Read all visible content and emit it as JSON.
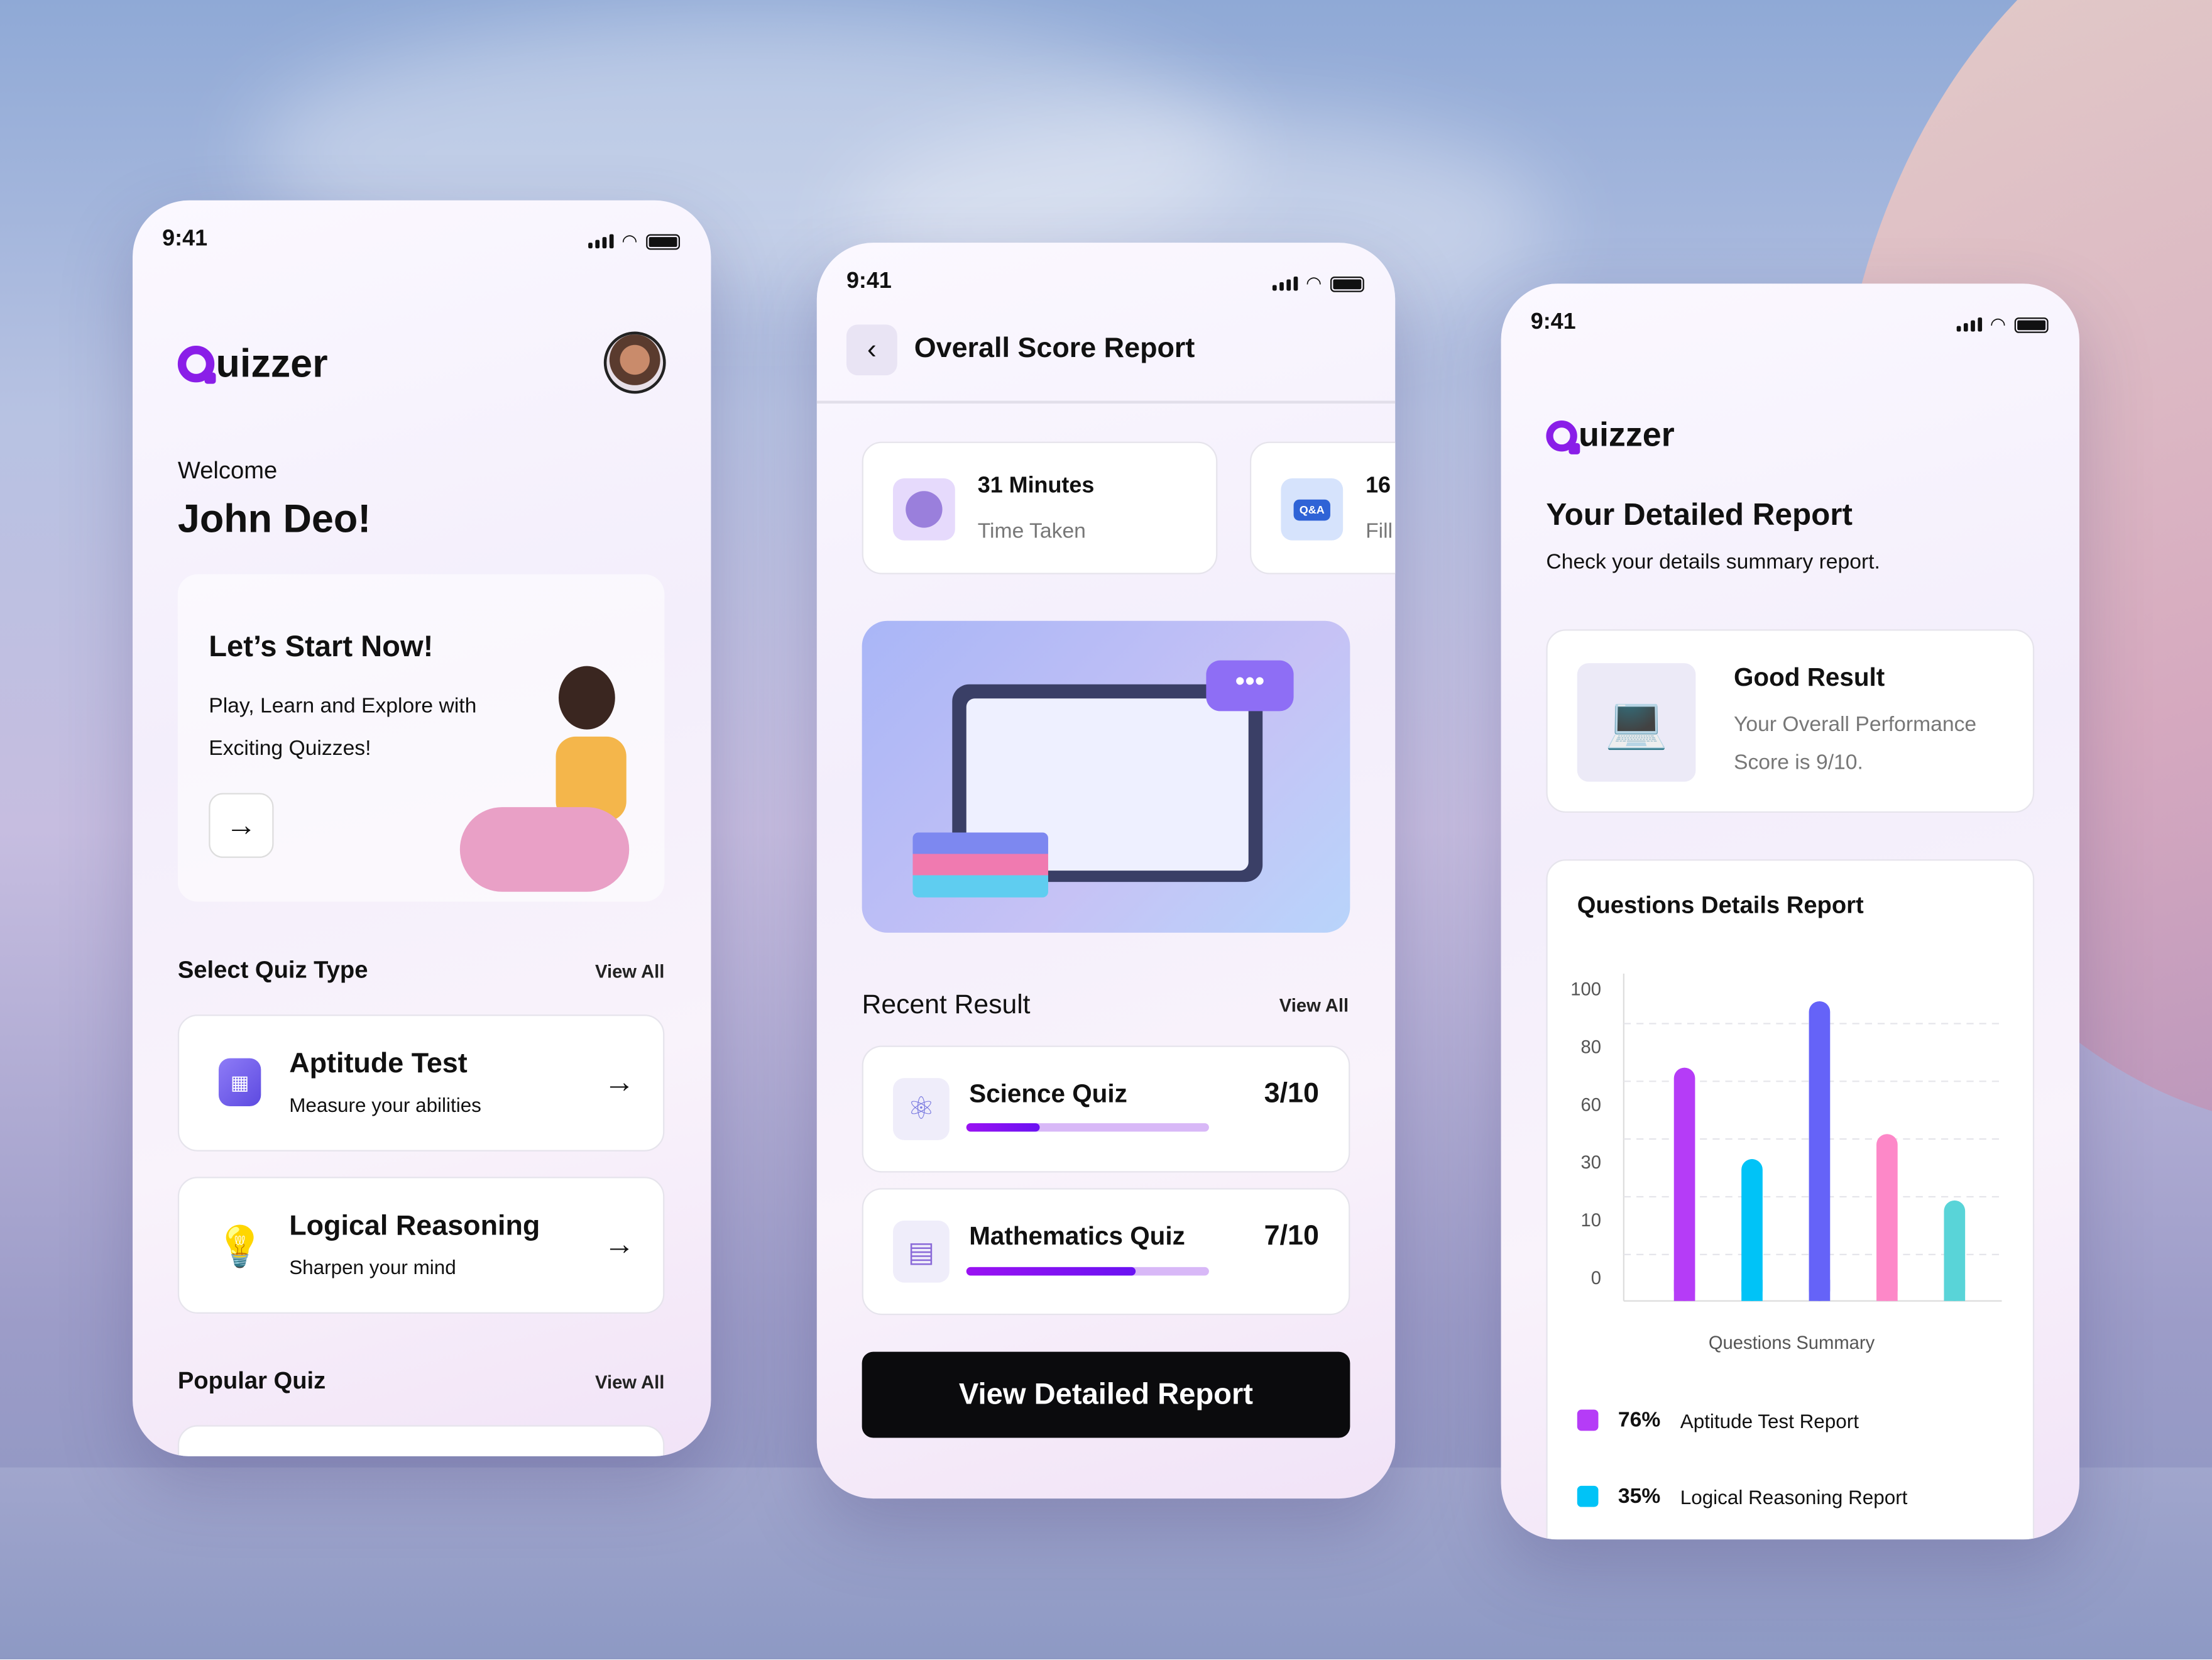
{
  "status_time": "9:41",
  "brand": {
    "name_rest": "uizzer",
    "accent": "#8a1ee8"
  },
  "home": {
    "welcome": "Welcome",
    "user_name": "John Deo!",
    "hero": {
      "title": "Let’s Start Now!",
      "line1": "Play, Learn and Explore with",
      "line2": "Exciting Quizzes!"
    },
    "select_quiz_type": "Select Quiz Type",
    "view_all": "View All",
    "quiz_types": [
      {
        "title": "Aptitude Test",
        "subtitle": "Measure your abilities",
        "icon": "calculator-icon"
      },
      {
        "title": "Logical Reasoning",
        "subtitle": "Sharpen your mind",
        "icon": "lightbulb-icon"
      }
    ],
    "popular_quiz": "Popular Quiz"
  },
  "score_report": {
    "title": "Overall Score Report",
    "stats": [
      {
        "value": "31 Minutes",
        "label": "Time Taken",
        "icon": "clock-icon"
      },
      {
        "value": "16",
        "label": "Fill",
        "icon": "qa-icon",
        "icon_text": "Q&A"
      }
    ],
    "recent_result": "Recent Result",
    "view_all": "View All",
    "results": [
      {
        "name": "Science Quiz",
        "score": "3/10",
        "progress": 0.3,
        "icon": "atom-icon"
      },
      {
        "name": "Mathematics Quiz",
        "score": "7/10",
        "progress": 0.7,
        "icon": "document-icon"
      }
    ],
    "cta": "View Detailed Report"
  },
  "detailed": {
    "title": "Your Detailed Report",
    "subtitle": "Check your details summary report.",
    "result_title": "Good Result",
    "result_line1": "Your Overall Performance",
    "result_line2": "Score is 9/10.",
    "chart_title": "Questions Details Report"
  },
  "chart_data": {
    "type": "bar",
    "title": "Questions Details Report",
    "xlabel": "Questions Summary",
    "ylabel": "",
    "y_ticks": [
      "0",
      "10",
      "30",
      "60",
      "80",
      "100"
    ],
    "categories": [
      "",
      "",
      "",
      "",
      ""
    ],
    "values": [
      73,
      32,
      96,
      45,
      17
    ],
    "colors": [
      "#b53cf7",
      "#00c3f7",
      "#6563f8",
      "#fd88c8",
      "#59d4d8"
    ],
    "grid": "dashed horizontal",
    "legend": [
      {
        "percent": "76%",
        "label": "Aptitude Test Report",
        "color": "#b53cf7"
      },
      {
        "percent": "35%",
        "label": "Logical Reasoning Report",
        "color": "#00c3f7"
      }
    ]
  }
}
